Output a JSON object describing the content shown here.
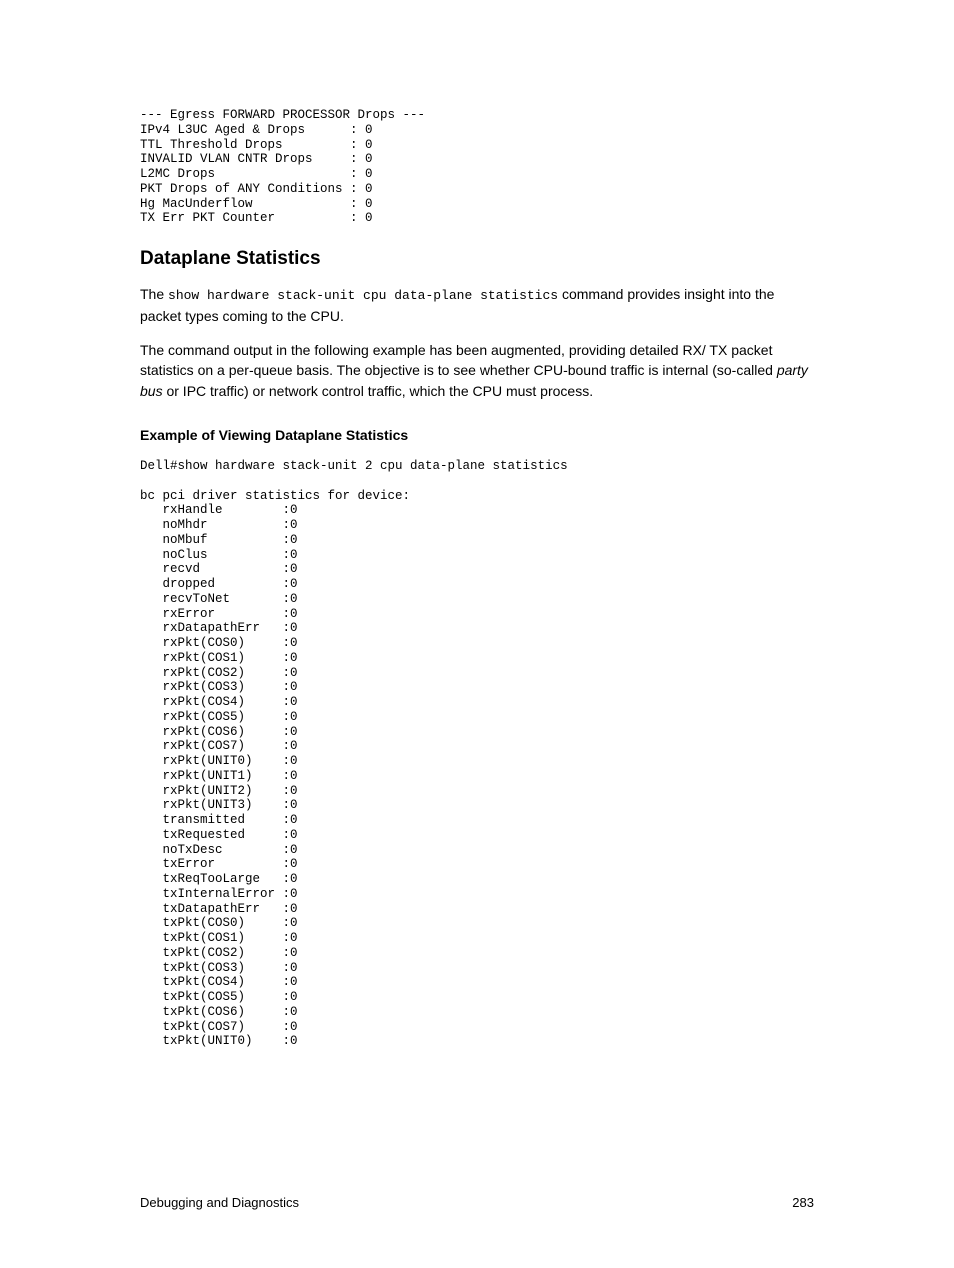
{
  "egressBlock": "--- Egress FORWARD PROCESSOR Drops ---\nIPv4 L3UC Aged & Drops      : 0\nTTL Threshold Drops         : 0\nINVALID VLAN CNTR Drops     : 0\nL2MC Drops                  : 0\nPKT Drops of ANY Conditions : 0\nHg MacUnderflow             : 0\nTX Err PKT Counter          : 0",
  "heading": "Dataplane Statistics",
  "para1_pre": "The ",
  "para1_code": "show hardware stack-unit cpu data-plane statistics",
  "para1_post": " command provides insight into the packet types coming to the CPU.",
  "para2_pre": "The command output in the following example has been augmented, providing detailed RX/ TX packet statistics on a per-queue basis. The objective is to see whether CPU-bound traffic is internal (so-called ",
  "para2_italic": "party bus",
  "para2_post": " or IPC traffic) or network control traffic, which the CPU must process.",
  "example_heading": "Example of Viewing Dataplane Statistics",
  "exampleBlock": "Dell#show hardware stack-unit 2 cpu data-plane statistics\n\nbc pci driver statistics for device:\n   rxHandle        :0\n   noMhdr          :0\n   noMbuf          :0\n   noClus          :0\n   recvd           :0\n   dropped         :0\n   recvToNet       :0\n   rxError         :0\n   rxDatapathErr   :0\n   rxPkt(COS0)     :0\n   rxPkt(COS1)     :0\n   rxPkt(COS2)     :0\n   rxPkt(COS3)     :0\n   rxPkt(COS4)     :0\n   rxPkt(COS5)     :0\n   rxPkt(COS6)     :0\n   rxPkt(COS7)     :0\n   rxPkt(UNIT0)    :0\n   rxPkt(UNIT1)    :0\n   rxPkt(UNIT2)    :0\n   rxPkt(UNIT3)    :0\n   transmitted     :0\n   txRequested     :0\n   noTxDesc        :0\n   txError         :0\n   txReqTooLarge   :0\n   txInternalError :0\n   txDatapathErr   :0\n   txPkt(COS0)     :0\n   txPkt(COS1)     :0\n   txPkt(COS2)     :0\n   txPkt(COS3)     :0\n   txPkt(COS4)     :0\n   txPkt(COS5)     :0\n   txPkt(COS6)     :0\n   txPkt(COS7)     :0\n   txPkt(UNIT0)    :0",
  "footer_left": "Debugging and Diagnostics",
  "footer_right": "283"
}
